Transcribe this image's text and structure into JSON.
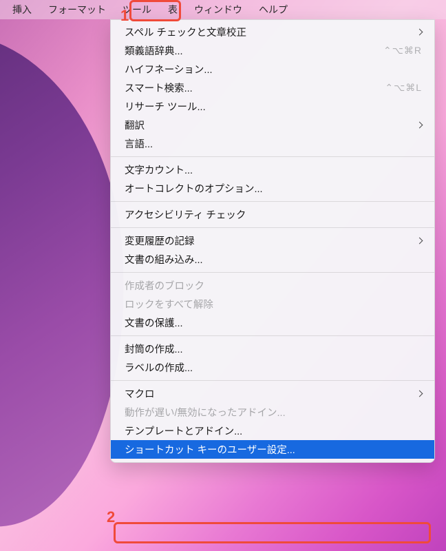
{
  "annotations": {
    "one": "1",
    "two": "2"
  },
  "menubar": {
    "items": [
      "挿入",
      "フォーマット",
      "ツール",
      "表",
      "ウィンドウ",
      "ヘルプ"
    ],
    "activeIndex": 2
  },
  "menu": {
    "groups": [
      [
        {
          "label": "スペル チェックと文章校正",
          "submenu": true
        },
        {
          "label": "類義語辞典...",
          "shortcut": "⌃⌥⌘R"
        },
        {
          "label": "ハイフネーション..."
        },
        {
          "label": "スマート検索...",
          "shortcut": "⌃⌥⌘L"
        },
        {
          "label": "リサーチ ツール..."
        },
        {
          "label": "翻訳",
          "submenu": true
        },
        {
          "label": "言語..."
        }
      ],
      [
        {
          "label": "文字カウント..."
        },
        {
          "label": "オートコレクトのオプション..."
        }
      ],
      [
        {
          "label": "アクセシビリティ チェック"
        }
      ],
      [
        {
          "label": "変更履歴の記録",
          "submenu": true
        },
        {
          "label": "文書の組み込み..."
        }
      ],
      [
        {
          "label": "作成者のブロック",
          "disabled": true
        },
        {
          "label": "ロックをすべて解除",
          "disabled": true
        },
        {
          "label": "文書の保護..."
        }
      ],
      [
        {
          "label": "封筒の作成..."
        },
        {
          "label": "ラベルの作成..."
        }
      ],
      [
        {
          "label": "マクロ",
          "submenu": true
        },
        {
          "label": "動作が遅い/無効になったアドイン...",
          "disabled": true
        },
        {
          "label": "テンプレートとアドイン..."
        },
        {
          "label": "ショートカット キーのユーザー設定...",
          "highlighted": true
        }
      ]
    ]
  }
}
